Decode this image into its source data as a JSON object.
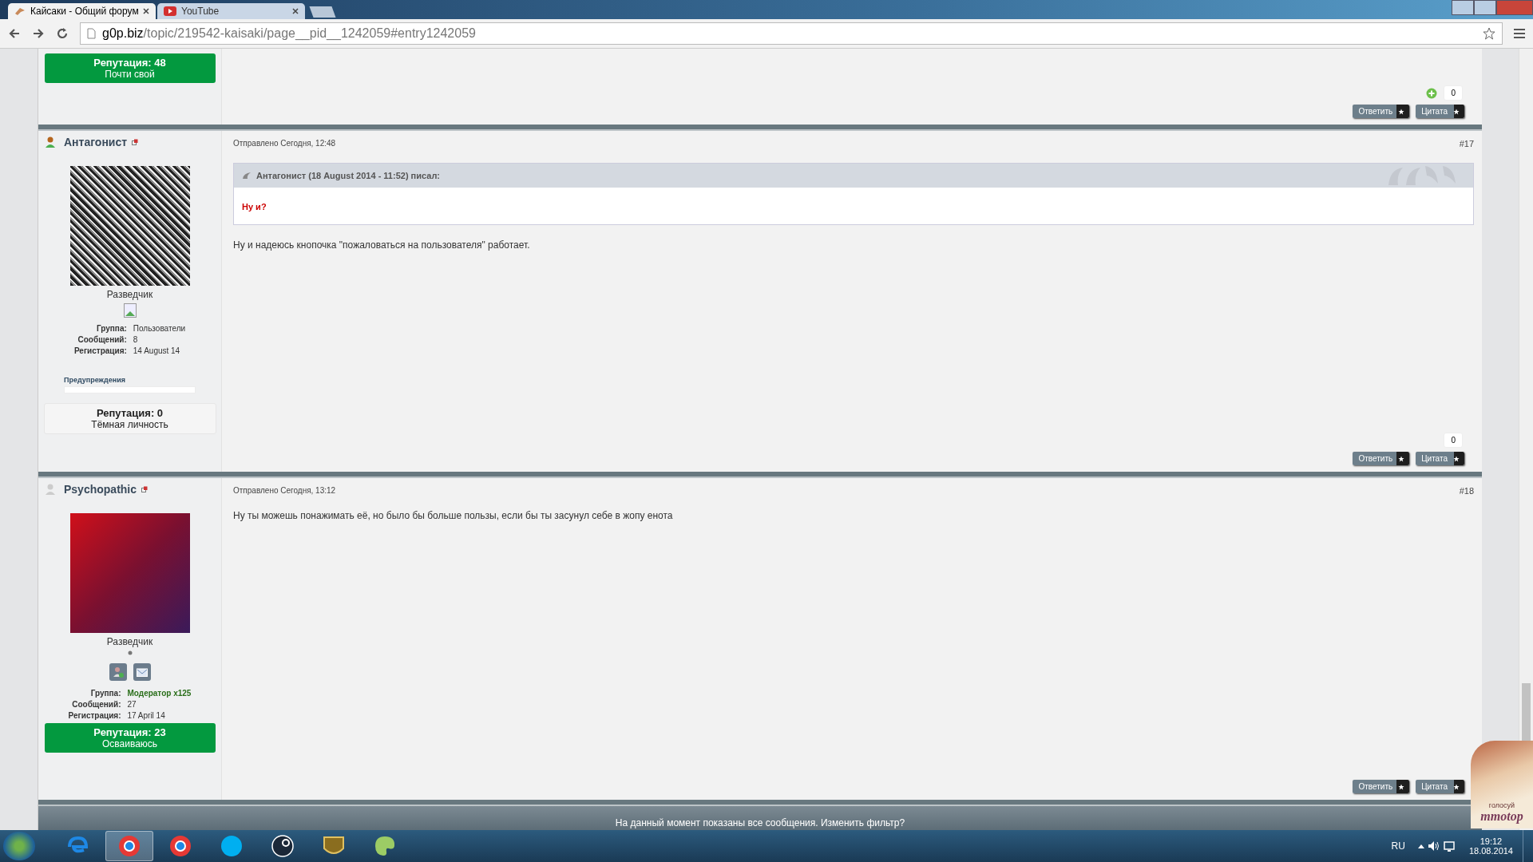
{
  "browser": {
    "tabs": [
      {
        "title": "Кайсаки - Общий форум",
        "selected": true,
        "kind": "forum"
      },
      {
        "title": "YouTube",
        "selected": false,
        "kind": "video"
      }
    ],
    "url": {
      "host": "g0p.biz",
      "path": "/topic/219542-kaisaki/page__pid__1242059#entry1242059"
    }
  },
  "top_post": {
    "reputation": {
      "kind": "positive",
      "label": "Репутация: 48",
      "title": "Почти свой"
    },
    "vote": {
      "plus": true,
      "count": "0"
    },
    "buttons": [
      "Ответить",
      "Цитата"
    ]
  },
  "posts": [
    {
      "author": "Антагонист",
      "online": true,
      "avatar": {
        "kind": "dark"
      },
      "rank": "Разведчик",
      "badge": {
        "kind": "broken"
      },
      "contact_icons": false,
      "info": [
        {
          "label": "Группа:",
          "value": "Пользователи",
          "emphasis": false
        },
        {
          "label": "Сообщений:",
          "value": "8",
          "emphasis": false
        },
        {
          "label": "Регистрация:",
          "value": "14 August 14",
          "emphasis": false
        }
      ],
      "warnings": {
        "label": "Предупреждения",
        "level": 0
      },
      "reputation": {
        "kind": "neutral",
        "label": "Репутация: 0",
        "title": "Тёмная личность"
      },
      "date": "Отправлено Сегодня, 12:48",
      "number": "#17",
      "quote": {
        "header": "Антагонист (18 August 2014 - 11:52) писал:",
        "text": "Ну и?"
      },
      "body": "Ну и надеюсь кнопочка \"пожаловаться на пользователя\" работает.",
      "vote": {
        "plus": false,
        "count": "0"
      },
      "buttons": [
        "Ответить",
        "Цитата"
      ]
    },
    {
      "author": "Psychopathic",
      "online": false,
      "avatar": {
        "kind": "red"
      },
      "rank": "Разведчик",
      "badge": {
        "kind": "dot"
      },
      "contact_icons": true,
      "info": [
        {
          "label": "Группа:",
          "value": "Модератор x125",
          "emphasis": true
        },
        {
          "label": "Сообщений:",
          "value": "27",
          "emphasis": false
        },
        {
          "label": "Регистрация:",
          "value": "17 April 14",
          "emphasis": false
        }
      ],
      "reputation": {
        "kind": "positive",
        "label": "Репутация: 23",
        "title": "Осваиваюсь"
      },
      "date": "Отправлено Сегодня, 13:12",
      "number": "#18",
      "body": "Ну ты можешь понажимать её, но было бы больше пользы, если бы ты засунул себе в жопу енота",
      "buttons": [
        "Ответить",
        "Цитата"
      ]
    }
  ],
  "filter_bar": "На данный момент показаны все сообщения. Изменить фильтр?",
  "banner": {
    "caption": "голосуй",
    "logo": "mmotop"
  },
  "taskbar": {
    "apps": [
      {
        "kind": "ie",
        "selected": false
      },
      {
        "kind": "chrome",
        "selected": true
      },
      {
        "kind": "chrome",
        "selected": false
      },
      {
        "kind": "skype",
        "selected": false
      },
      {
        "kind": "steam",
        "selected": false
      },
      {
        "kind": "wow",
        "selected": false
      },
      {
        "kind": "paint",
        "selected": false
      }
    ],
    "language": "RU",
    "time": "19:12",
    "date": "18.08.2014"
  }
}
